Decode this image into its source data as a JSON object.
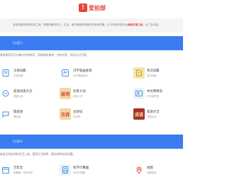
{
  "header": {
    "logo_char": "!",
    "logo_text": "爱拍部"
  },
  "intro": {
    "text_before": "本网站提供多种实用工具，帮助您解决学习、生活、娱乐等各类场景中的各种问题。以下所有内容均为",
    "highlight": "免费实用工具",
    "text_after": "，全广告内容。"
  },
  "sections": [
    {
      "tag": "[分类1]",
      "desc": "收录常用汉字词典与传统知识，帮助高效查询、分析问答、知识点记住等。",
      "tools": [
        {
          "name": "汉语词典",
          "sub": "汉语词典",
          "icon": "dictionary-icon",
          "glyph": "",
          "color": "#ffffff",
          "fg": "#4a90e2"
        },
        {
          "name": "汉字笔画查询",
          "sub": "汉字笔画查询",
          "icon": "stroke-lookup-icon",
          "glyph": "",
          "color": "#ffffff",
          "fg": "#4a90e2"
        },
        {
          "name": "英汉词典",
          "sub": "英汉词典",
          "icon": "en-cn-dict-icon",
          "glyph": "",
          "color": "#f5e6a8",
          "fg": "#c89b2a"
        },
        {
          "name": "成语词语大全",
          "sub": "成语大全",
          "icon": "idiom-icon",
          "glyph": "",
          "color": "#ffffff",
          "fg": "#4a90e2"
        },
        {
          "name": "近反义词",
          "sub": "近反义词",
          "icon": "synonym-icon",
          "glyph": "组词",
          "color": "#f3d6a4",
          "fg": "#c23a2a"
        },
        {
          "name": "中文转拼音",
          "sub": "中文转拼音",
          "icon": "pinyin-icon",
          "glyph": "",
          "color": "#eaf2fb",
          "fg": "#4a90e2"
        },
        {
          "name": "歇后语",
          "sub": "歇后语",
          "icon": "xiehouyu-icon",
          "glyph": "",
          "color": "#ffffff",
          "fg": "#4a90e2"
        },
        {
          "name": "古诗词",
          "sub": "古诗词",
          "icon": "poetry-icon",
          "glyph": "古诗",
          "color": "#f3d6a4",
          "fg": "#c23a2a"
        },
        {
          "name": "成语大全",
          "sub": "成语大全",
          "icon": "idiom-book-icon",
          "glyph": "成语",
          "color": "#a8322a",
          "fg": "#f5e6a8"
        }
      ]
    },
    {
      "tag": "[分类2]",
      "desc": "收录日常实用的生活工具，提高生活效率，解决各种实际问题。",
      "tools": [
        {
          "name": "万年历",
          "sub": "查看每一天的日历",
          "icon": "calendar-icon",
          "glyph": "",
          "color": "#ffffff",
          "fg": "#4a90e2"
        },
        {
          "name": "科学计算器",
          "sub": "科学计算器",
          "icon": "calculator-icon",
          "glyph": "",
          "color": "#eaf2fb",
          "fg": "#4a90e2"
        },
        {
          "name": "地图",
          "sub": "地图查询",
          "icon": "map-icon",
          "glyph": "",
          "color": "#ffffff",
          "fg": "#e8443b"
        }
      ]
    }
  ]
}
